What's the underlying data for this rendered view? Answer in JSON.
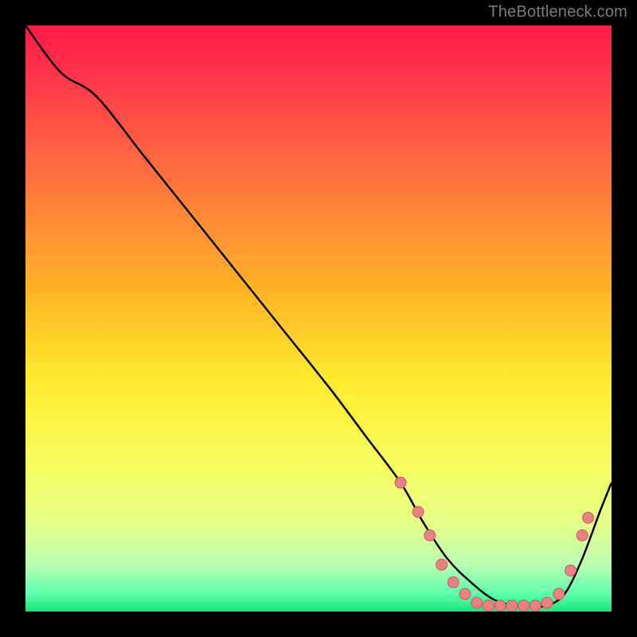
{
  "attribution": "TheBottleneck.com",
  "colors": {
    "gradient_stops": [
      {
        "offset": 0.0,
        "color": "#ff1a47"
      },
      {
        "offset": 0.1,
        "color": "#ff3a4a"
      },
      {
        "offset": 0.25,
        "color": "#ff6f3f"
      },
      {
        "offset": 0.45,
        "color": "#ffb327"
      },
      {
        "offset": 0.6,
        "color": "#ffe92d"
      },
      {
        "offset": 0.75,
        "color": "#f6ff5f"
      },
      {
        "offset": 0.85,
        "color": "#e6ff8a"
      },
      {
        "offset": 0.92,
        "color": "#b9ffb0"
      },
      {
        "offset": 0.97,
        "color": "#5cffae"
      },
      {
        "offset": 1.0,
        "color": "#18e47f"
      }
    ],
    "curve": "#000000",
    "marker_fill": "#e98383",
    "marker_stroke": "#c75e5e",
    "background_outer": "#000000"
  },
  "chart_data": {
    "type": "line",
    "title": "",
    "xlabel": "",
    "ylabel": "",
    "xlim": [
      0,
      100
    ],
    "ylim": [
      0,
      100
    ],
    "series": [
      {
        "name": "bottleneck-curve",
        "x": [
          0,
          6,
          12,
          20,
          28,
          36,
          44,
          52,
          58,
          64,
          68,
          72,
          76,
          80,
          84,
          87,
          89,
          92,
          95,
          98,
          100
        ],
        "y": [
          100,
          92,
          88,
          78,
          68,
          58,
          48,
          38,
          30,
          22,
          15,
          9,
          5,
          2,
          1,
          1,
          1,
          3,
          9,
          17,
          22
        ]
      }
    ],
    "markers": [
      {
        "x": 64,
        "y": 22
      },
      {
        "x": 67,
        "y": 17
      },
      {
        "x": 69,
        "y": 13
      },
      {
        "x": 71,
        "y": 8
      },
      {
        "x": 73,
        "y": 5
      },
      {
        "x": 75,
        "y": 3
      },
      {
        "x": 77,
        "y": 1.5
      },
      {
        "x": 79,
        "y": 1
      },
      {
        "x": 81,
        "y": 1
      },
      {
        "x": 83,
        "y": 1
      },
      {
        "x": 85,
        "y": 1
      },
      {
        "x": 87,
        "y": 1
      },
      {
        "x": 89,
        "y": 1.5
      },
      {
        "x": 91,
        "y": 3
      },
      {
        "x": 93,
        "y": 7
      },
      {
        "x": 95,
        "y": 13
      },
      {
        "x": 96,
        "y": 16
      }
    ]
  }
}
